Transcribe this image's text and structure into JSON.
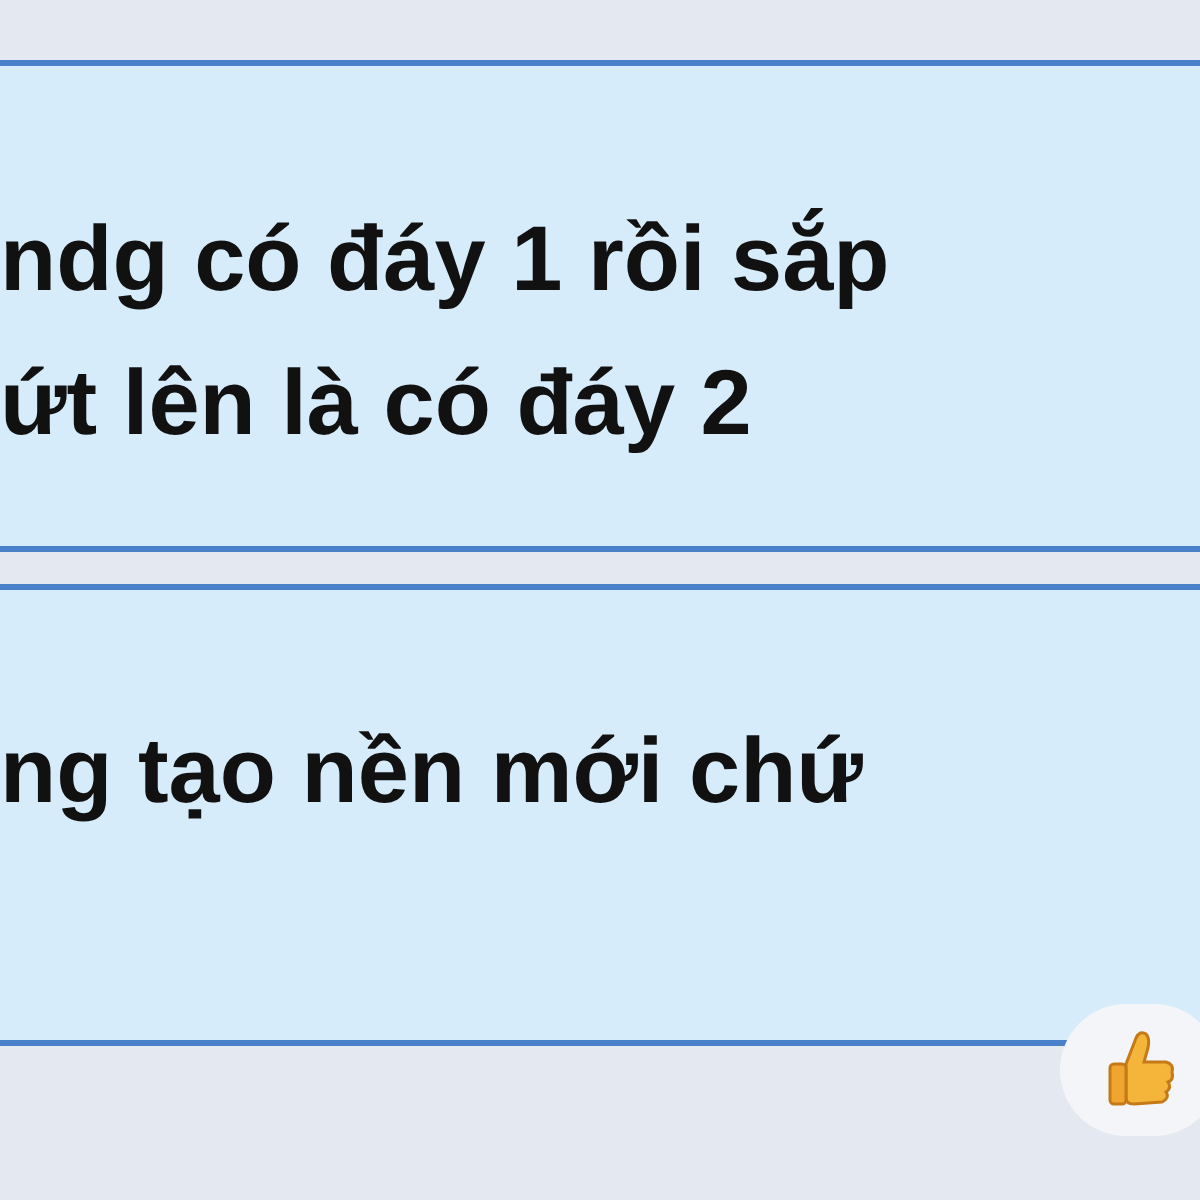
{
  "messages": [
    {
      "lines": [
        "ndg có đáy 1 rồi sắp",
        "ứt lên là có đáy 2"
      ]
    },
    {
      "lines": [
        "ng tạo nền mới chứ"
      ],
      "reacted": true
    }
  ]
}
